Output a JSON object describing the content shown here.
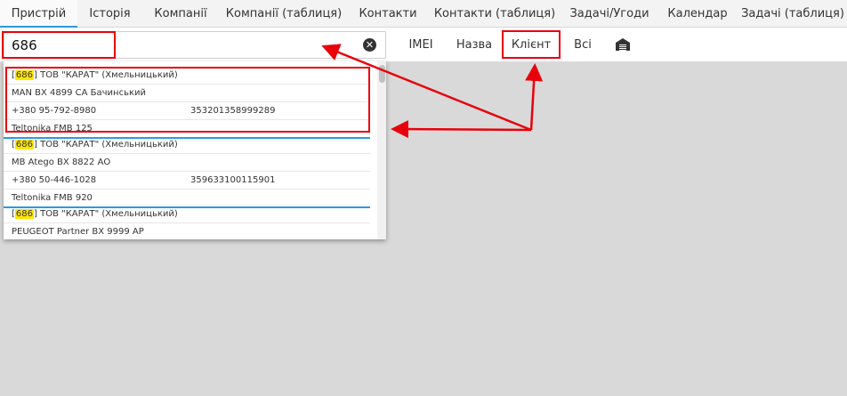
{
  "tabs": [
    {
      "label": "Пристрій",
      "active": true
    },
    {
      "label": "Історія"
    },
    {
      "label": "Компанії"
    },
    {
      "label": "Компанії (таблиця)"
    },
    {
      "label": "Контакти"
    },
    {
      "label": "Контакти (таблиця)"
    },
    {
      "label": "Задачі/Угоди"
    },
    {
      "label": "Календар"
    },
    {
      "label": "Задачі (таблиця)"
    }
  ],
  "search": {
    "value": "686"
  },
  "filters": {
    "imei": "IMEI",
    "name": "Назва",
    "client": "Клієнт",
    "all": "Всі"
  },
  "results": [
    {
      "id": "686",
      "company": "ТОВ \"КАРАТ\" (Хмельницький)",
      "vehicle": "MAN ВХ 4899 СА Бачинський",
      "phone": "+380 95-792-8980",
      "imei": "353201358999289",
      "tracker": "Teltonika FMB 125"
    },
    {
      "id": "686",
      "company": "ТОВ \"КАРАТ\" (Хмельницький)",
      "vehicle": "MB Atego ВХ 8822 АО",
      "phone": "+380 50-446-1028",
      "imei": "359633100115901",
      "tracker": "Teltonika FMB 920"
    },
    {
      "id": "686",
      "company": "ТОВ \"КАРАТ\" (Хмельницький)",
      "vehicle": "PEUGEOT Partner ВХ 9999 АР",
      "phone": "",
      "imei": "",
      "tracker": ""
    }
  ],
  "colors": {
    "accent": "#2a9be0",
    "annotation": "#e8000b",
    "highlight": "#ffe600",
    "content_bg": "#d9d9d9"
  }
}
